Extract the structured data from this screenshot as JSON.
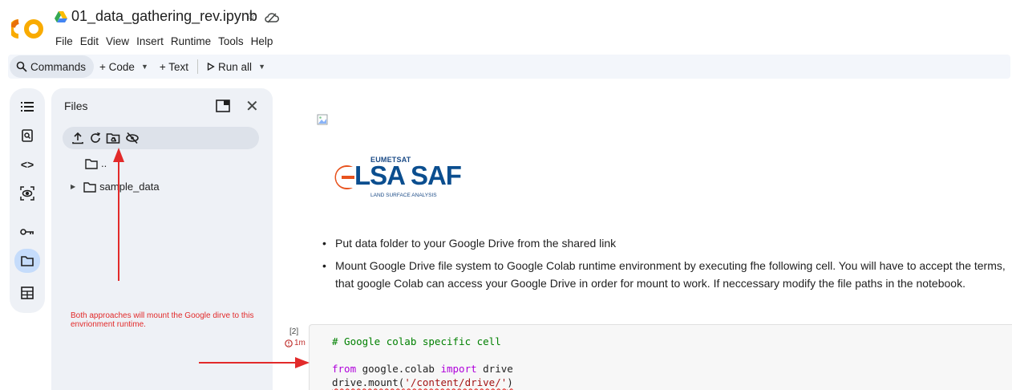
{
  "header": {
    "title": "01_data_gathering_rev.ipynb",
    "menu": [
      "File",
      "Edit",
      "View",
      "Insert",
      "Runtime",
      "Tools",
      "Help"
    ]
  },
  "toolbar": {
    "commands": "Commands",
    "code": "+ Code",
    "text": "+ Text",
    "run_all": "Run all"
  },
  "files_panel": {
    "title": "Files",
    "items": [
      {
        "label": ".."
      },
      {
        "label": "sample_data"
      }
    ]
  },
  "annotation": {
    "text": "Both approaches will mount the Google dirve to this envrionment runtime."
  },
  "content": {
    "logo": {
      "top": "EUMETSAT",
      "main": "LSA SAF",
      "sub": "LAND SURFACE ANALYSIS"
    },
    "bullets": [
      "Put data folder to your Google Drive from the shared link",
      "Mount Google Drive file system to Google Colab runtime environment by executing fhe following cell. You will have to accept the terms, that google Colab can access your Google Drive in order for mount to work. If neccessary modify the file paths in the notebook."
    ]
  },
  "cell": {
    "exec_count": "[2]",
    "exec_time": "1m",
    "code": {
      "comment": "# Google colab specific cell",
      "from_kw": "from",
      "module": " google.colab ",
      "import_kw": "import",
      "name": " drive",
      "call": "drive.mount(",
      "arg": "'/content/drive/'",
      "close": ")"
    }
  },
  "colors": {
    "accent": "#0b57d0",
    "annotation": "#e22a2a",
    "logo_blue": "#0b4e8f",
    "logo_orange": "#e8531e"
  }
}
